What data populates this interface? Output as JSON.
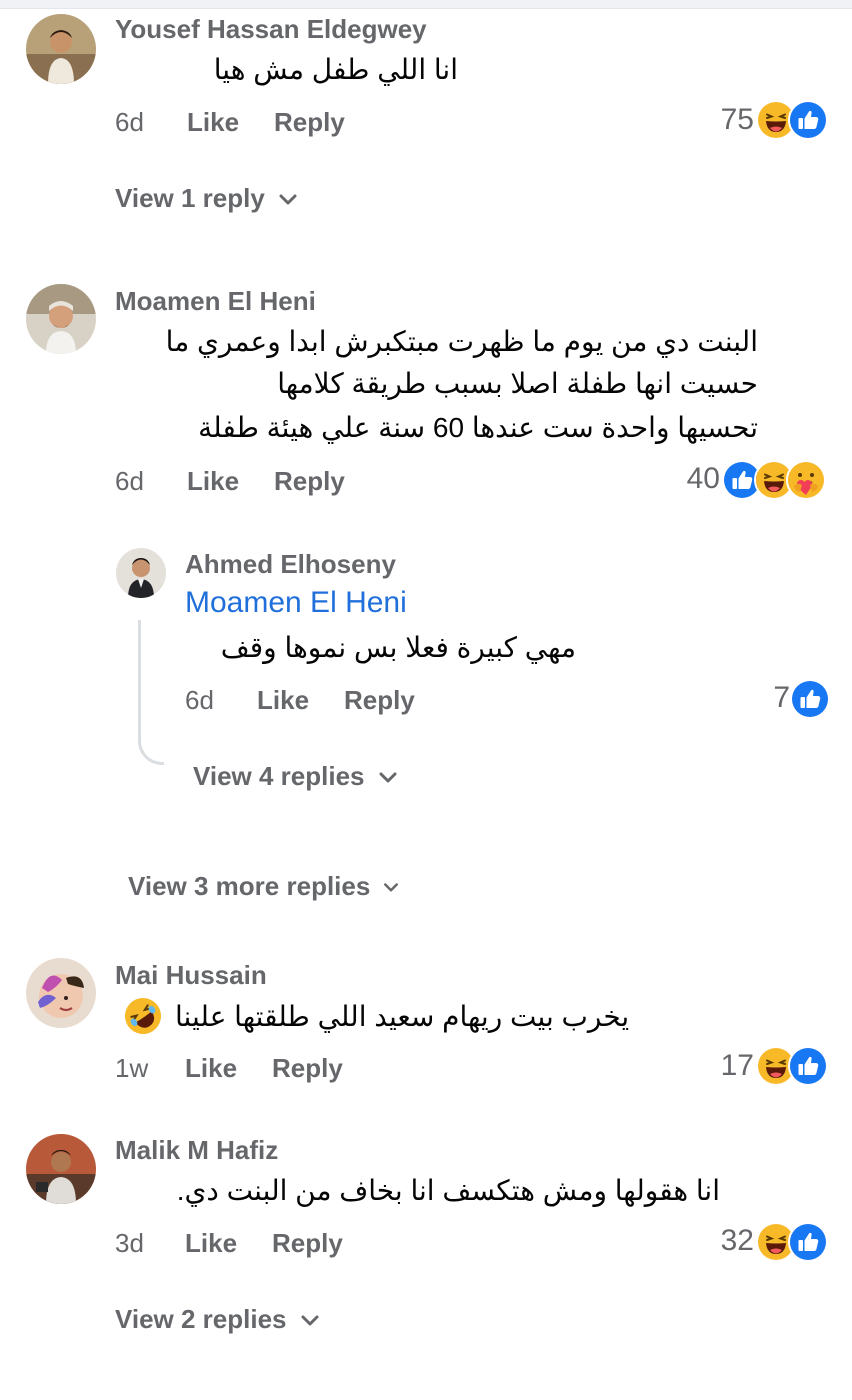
{
  "comments": [
    {
      "author": "Yousef Hassan Eldegwey",
      "text": "انا اللي طفل مش هيا",
      "time": "6d",
      "like": "Like",
      "reply": "Reply",
      "reaction_count": "75",
      "reactions": [
        "like-icon",
        "haha-icon"
      ],
      "view_replies": "View 1 reply"
    },
    {
      "author": "Moamen El Heni",
      "text_lines": [
        "البنت دي من يوم ما ظهرت مبتكبرش ابدا وعمري ما",
        "حسيت انها طفلة اصلا بسبب طريقة كلامها",
        "تحسيها واحدة ست عندها 60 سنة علي هيئة طفلة"
      ],
      "time": "6d",
      "like": "Like",
      "reply": "Reply",
      "reaction_count": "40",
      "reactions": [
        "care-icon",
        "haha-icon",
        "like-icon"
      ],
      "nested_reply": {
        "author": "Ahmed Elhoseny",
        "mention": "Moamen El Heni",
        "text": "مهي كبيرة فعلا بس نموها وقف",
        "time": "6d",
        "like": "Like",
        "reply": "Reply",
        "reaction_count": "7",
        "reactions": [
          "like-icon"
        ],
        "view_replies": "View 4 replies"
      },
      "view_more_replies": "View 3 more replies"
    },
    {
      "author": "Mai Hussain",
      "text": "يخرب بيت ريهام سعيد اللي طلقتها علينا",
      "emoji": "rofl-emoji",
      "time": "1w",
      "like": "Like",
      "reply": "Reply",
      "reaction_count": "17",
      "reactions": [
        "like-icon",
        "haha-icon"
      ]
    },
    {
      "author": "Malik M Hafiz",
      "text": "انا هقولها ومش هتكسف انا بخاف من البنت دي.",
      "time": "3d",
      "like": "Like",
      "reply": "Reply",
      "reaction_count": "32",
      "reactions": [
        "like-icon",
        "haha-icon"
      ],
      "view_replies": "View 2 replies"
    }
  ],
  "colors": {
    "meta": "#65676b",
    "mention": "#216fdb",
    "like": "#1877f2",
    "haha": "#f7b928",
    "thread": "#dadde1"
  }
}
